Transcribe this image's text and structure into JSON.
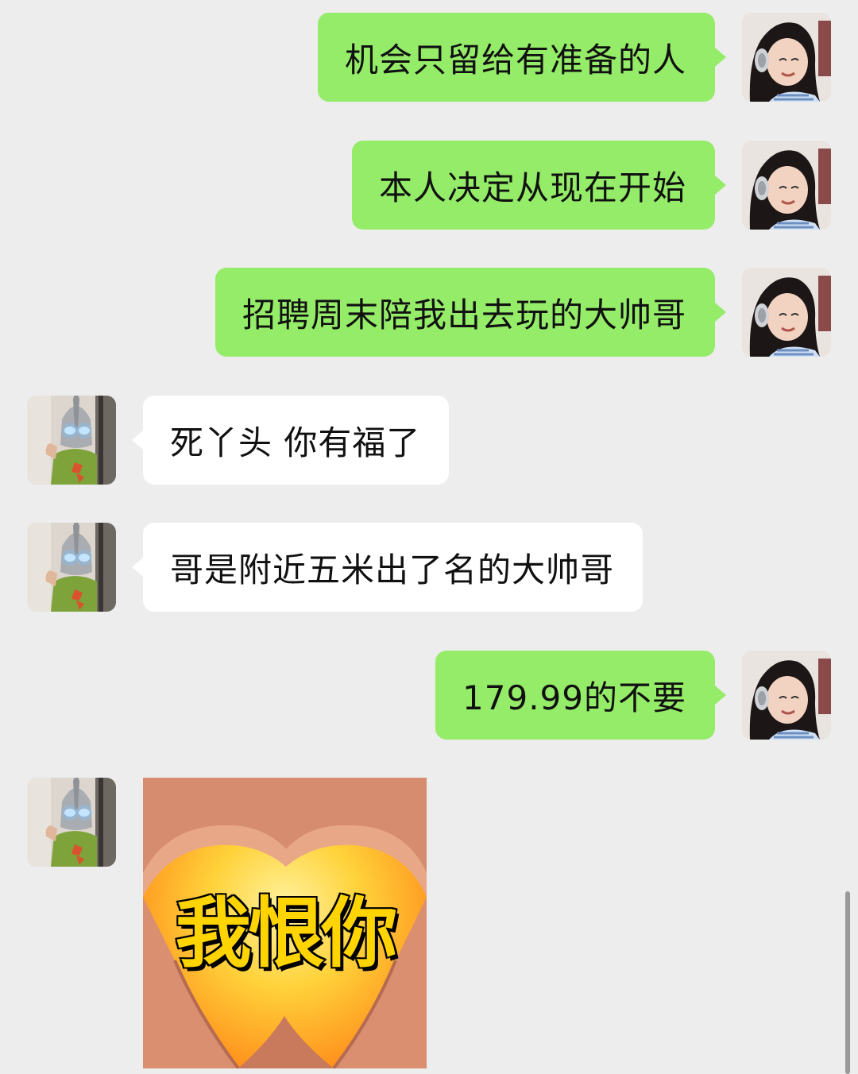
{
  "messages": [
    {
      "side": "self",
      "text": "机会只留给有准备的人"
    },
    {
      "side": "self",
      "text": "本人决定从现在开始"
    },
    {
      "side": "self",
      "text": "招聘周末陪我出去玩的大帅哥"
    },
    {
      "side": "other",
      "text": "死丫头 你有福了"
    },
    {
      "side": "other",
      "text": "哥是附近五米出了名的大帅哥"
    },
    {
      "side": "self",
      "text": "179.99的不要"
    },
    {
      "side": "other",
      "type": "sticker",
      "text": "我恨你"
    }
  ],
  "colors": {
    "background": "#ededed",
    "self_bubble": "#95ec69",
    "other_bubble": "#ffffff"
  },
  "icons": {
    "self_avatar": "girl-with-headphones-avatar",
    "other_avatar": "ultraman-mask-avatar",
    "sticker": "heart-hands-sticker"
  }
}
